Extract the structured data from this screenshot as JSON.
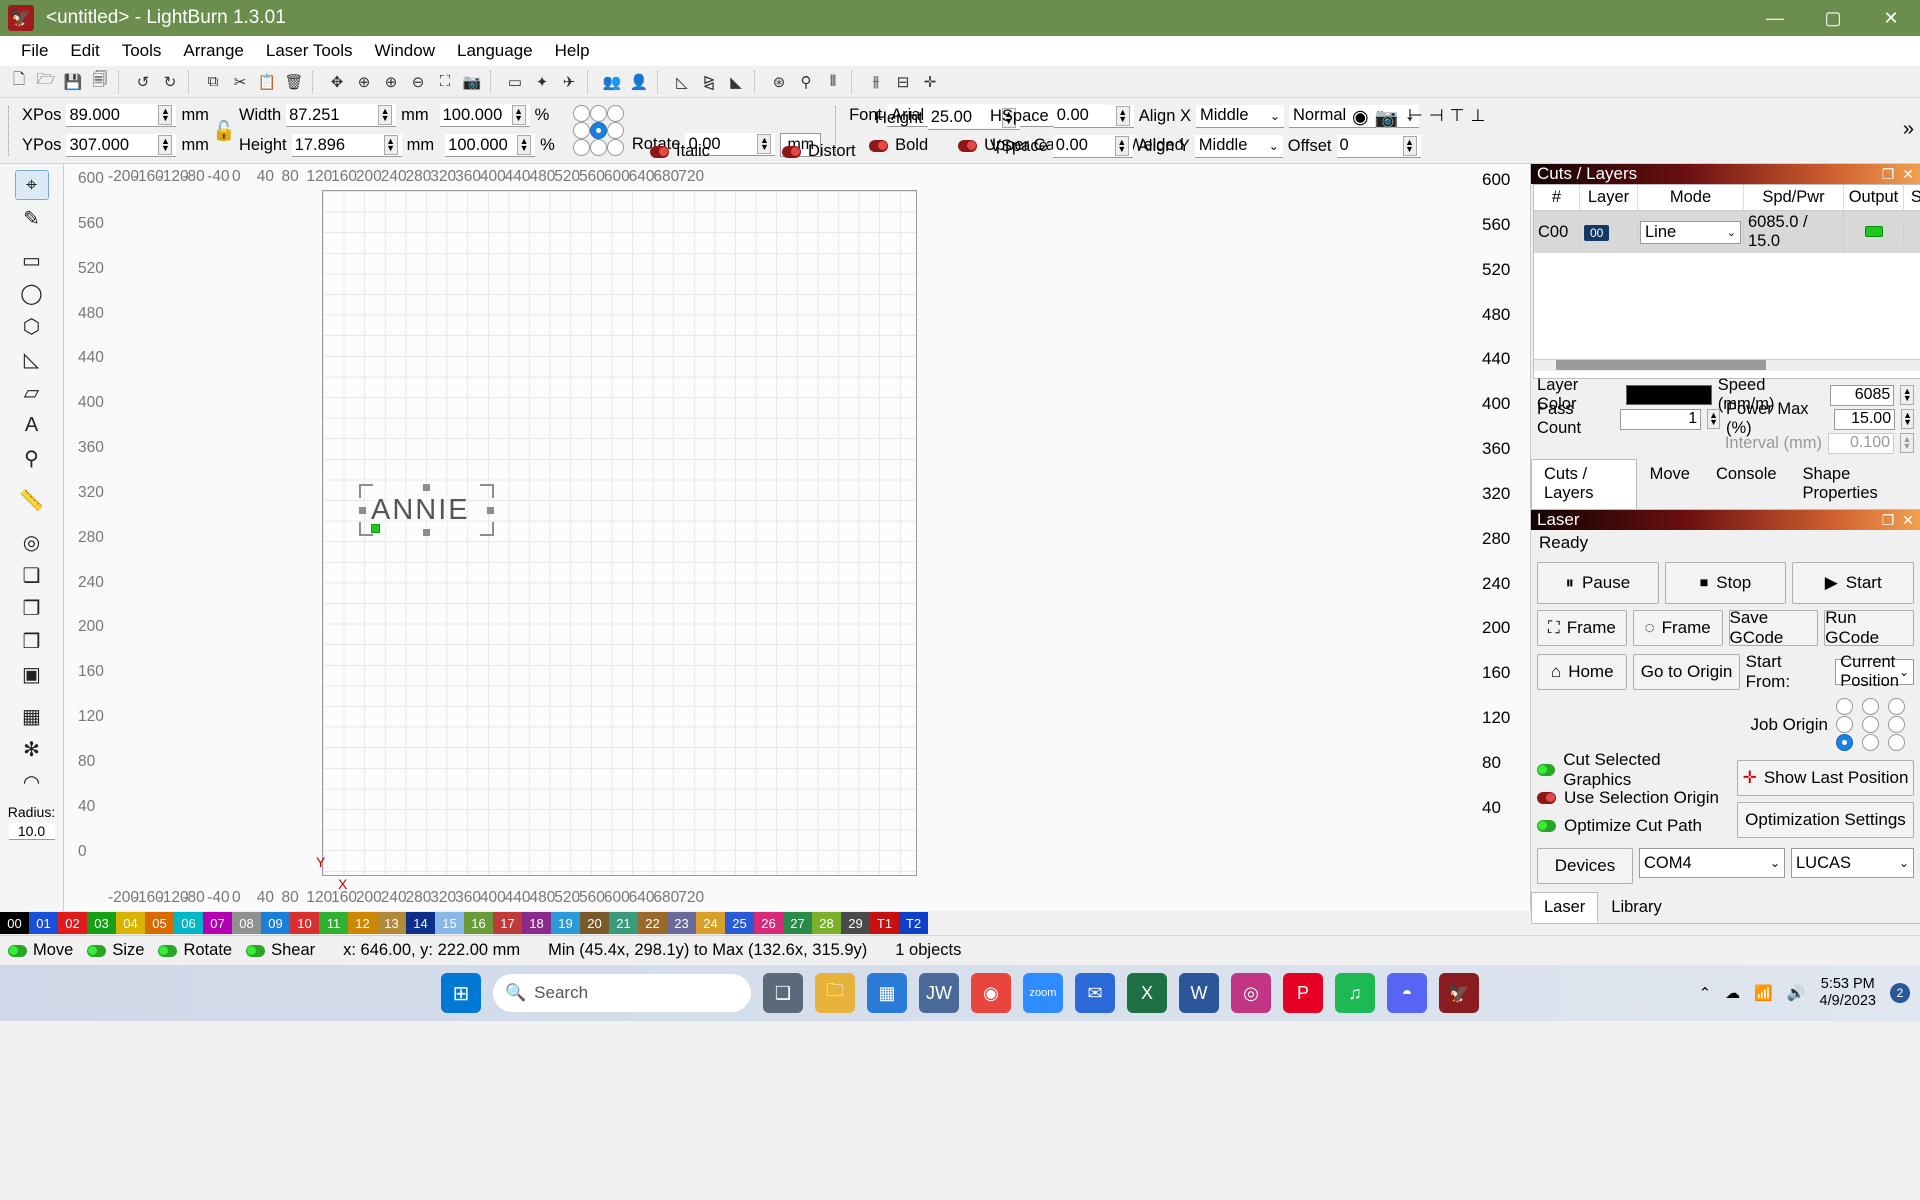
{
  "window": {
    "title": "<untitled> - LightBurn 1.3.01",
    "minimize": "—",
    "maximize": "▢",
    "close": "✕"
  },
  "menu": [
    "File",
    "Edit",
    "Tools",
    "Arrange",
    "Laser Tools",
    "Window",
    "Language",
    "Help"
  ],
  "toolbar_icons": [
    "new-file-icon",
    "open-file-icon",
    "save-file-icon",
    "export-file-icon",
    "undo-icon",
    "redo-icon",
    "copy-icon",
    "cut-icon",
    "paste-icon",
    "delete-icon",
    "move-icon",
    "zoom-icon",
    "zoom-in-icon",
    "zoom-out-icon",
    "frame-select-icon",
    "camera-icon",
    "fit-view-icon",
    "node-edit-icon",
    "boolean-icon",
    "group-icon",
    "ungroup-icon",
    "offset-icon",
    "mirror-h-icon",
    "mirror-v-icon",
    "weld-icon",
    "array-icon",
    "measure-icon",
    "align-icon",
    "distribute-icon",
    "center-icon"
  ],
  "properties": {
    "xpos_label": "XPos",
    "xpos_value": "89.000",
    "xpos_unit": "mm",
    "ypos_label": "YPos",
    "ypos_value": "307.000",
    "ypos_unit": "mm",
    "lock_icon": "unlock-icon",
    "width_label": "Width",
    "width_value": "87.251",
    "width_unit": "mm",
    "width_pct": "100.000",
    "pct_unit": "%",
    "height_label": "Height",
    "height_value": "17.896",
    "height_unit": "mm",
    "height_pct": "100.000",
    "rotate_label": "Rotate",
    "rotate_value": "0.00",
    "rotate_unit": "mm",
    "anchor_selected_index": 4,
    "more_icon": "chevron-right-icon"
  },
  "text_props": {
    "font_label": "Font",
    "font_value": "Arial",
    "height_label": "Height",
    "height_value": "25.00",
    "hspace_label": "HSpace",
    "hspace_value": "0.00",
    "vspace_label": "VSpace",
    "vspace_value": "0.00",
    "bold_label": "Bold",
    "bold_on": false,
    "italic_label": "Italic",
    "italic_on": false,
    "upper_label": "Upper Case",
    "upper_on": false,
    "distort_label": "Distort",
    "distort_on": false,
    "welded_label": "Welded",
    "welded_on": true,
    "align_x_label": "Align X",
    "align_x_value": "Middle",
    "align_y_label": "Align Y",
    "align_y_value": "Middle",
    "normal_value": "Normal",
    "offset_label": "Offset",
    "offset_value": "0"
  },
  "tools_palette": [
    {
      "name": "select-tool",
      "glyph": "⌖",
      "selected": true
    },
    {
      "name": "edit-nodes-tool",
      "glyph": "✎",
      "selected": false
    },
    {
      "name": "rectangle-tool",
      "glyph": "▭",
      "selected": false
    },
    {
      "name": "ellipse-tool",
      "glyph": "◯",
      "selected": false
    },
    {
      "name": "polygon-tool",
      "glyph": "⬡",
      "selected": false
    },
    {
      "name": "draw-line-tool",
      "glyph": "◺",
      "selected": false
    },
    {
      "name": "closed-path-tool",
      "glyph": "▱",
      "selected": false
    },
    {
      "name": "text-tool",
      "glyph": "A",
      "selected": false
    },
    {
      "name": "position-tool",
      "glyph": "⚲",
      "selected": false
    },
    {
      "name": "measure-tool",
      "glyph": "📏",
      "selected": false
    },
    {
      "name": "offset-shapes-tool",
      "glyph": "◎",
      "selected": false
    },
    {
      "name": "boolean-union-tool",
      "glyph": "❏",
      "selected": false
    },
    {
      "name": "boolean-subtract-tool",
      "glyph": "❐",
      "selected": false
    },
    {
      "name": "boolean-intersect-tool",
      "glyph": "❒",
      "selected": false
    },
    {
      "name": "boolean-exclude-tool",
      "glyph": "▣",
      "selected": false
    },
    {
      "name": "grid-array-tool",
      "glyph": "▦",
      "selected": false
    },
    {
      "name": "circular-array-tool",
      "glyph": "✻",
      "selected": false
    },
    {
      "name": "radius-tool",
      "glyph": "◠",
      "selected": false
    }
  ],
  "radius": {
    "label": "Radius:",
    "value": "10.0"
  },
  "canvas": {
    "ruler_top": [
      "-200",
      "-160",
      "-120",
      "-80",
      "-40",
      "0",
      "40",
      "80",
      "120",
      "160",
      "200",
      "240",
      "280",
      "320",
      "360",
      "400",
      "440",
      "480",
      "520",
      "560",
      "600",
      "640",
      "680",
      "720"
    ],
    "ruler_bottom": [
      "-200",
      "-160",
      "-120",
      "-80",
      "-40",
      "0",
      "40",
      "80",
      "120",
      "160",
      "200",
      "240",
      "280",
      "320",
      "360",
      "400",
      "440",
      "480",
      "520",
      "560",
      "600",
      "640",
      "680",
      "720"
    ],
    "ruler_left": [
      "600",
      "560",
      "520",
      "480",
      "440",
      "400",
      "360",
      "320",
      "280",
      "240",
      "200",
      "160",
      "120",
      "80",
      "40",
      "0"
    ],
    "ruler_right": [
      "600",
      "560",
      "520",
      "480",
      "440",
      "400",
      "360",
      "320",
      "280",
      "240",
      "200",
      "160",
      "120",
      "80",
      "40"
    ],
    "origin_x_label": "X",
    "origin_y_label": "Y",
    "object_text": "ANNIE"
  },
  "cuts_panel": {
    "title": "Cuts / Layers",
    "undock_icon": "undock-icon",
    "close_icon": "close-icon",
    "columns": [
      "#",
      "Layer",
      "Mode",
      "Spd/Pwr",
      "Output",
      "Show"
    ],
    "rows": [
      {
        "num": "C00",
        "layer": "00",
        "mode": "Line",
        "spd_pwr": "6085.0 / 15.0",
        "output": true,
        "show": true
      }
    ],
    "side_icons": [
      "scroll-up-icon",
      "scroll-down-icon",
      "delete-icon",
      "move-right-icon",
      "move-left-icon"
    ],
    "layer_color_label": "Layer Color",
    "layer_color_value": "#000000",
    "speed_label": "Speed (mm/m)",
    "speed_value": "6085",
    "pass_count_label": "Pass Count",
    "pass_count_value": "1",
    "power_max_label": "Power Max (%)",
    "power_max_value": "15.00",
    "interval_label": "Interval (mm)",
    "interval_value": "0.100"
  },
  "dock_tabs": [
    {
      "label": "Cuts / Layers",
      "active": true
    },
    {
      "label": "Move",
      "active": false
    },
    {
      "label": "Console",
      "active": false
    },
    {
      "label": "Shape Properties",
      "active": false
    }
  ],
  "laser_panel": {
    "title": "Laser",
    "status": "Ready",
    "pause_label": "Pause",
    "stop_label": "Stop",
    "start_label": "Start",
    "frame_label": "Frame",
    "frame_round_label": "Frame",
    "save_gcode_label": "Save GCode",
    "run_gcode_label": "Run GCode",
    "home_label": "Home",
    "go_to_origin_label": "Go to Origin",
    "start_from_label": "Start From:",
    "start_from_value": "Current Position",
    "job_origin_label": "Job Origin",
    "job_origin_index": 6,
    "cut_selected_label": "Cut Selected Graphics",
    "cut_selected_on": true,
    "use_selection_origin_label": "Use Selection Origin",
    "use_selection_origin_on": false,
    "optimize_cut_label": "Optimize Cut Path",
    "optimize_cut_on": true,
    "show_last_position_label": "Show Last Position",
    "optimization_settings_label": "Optimization Settings",
    "devices_label": "Devices",
    "port_value": "COM4",
    "device_value": "LUCAS"
  },
  "bottom_tabs": [
    {
      "label": "Laser",
      "active": true
    },
    {
      "label": "Library",
      "active": false
    }
  ],
  "palette": [
    {
      "label": "00",
      "color": "#000000"
    },
    {
      "label": "01",
      "color": "#1b4fd8"
    },
    {
      "label": "02",
      "color": "#e01b1b"
    },
    {
      "label": "03",
      "color": "#15a015"
    },
    {
      "label": "04",
      "color": "#d8b400"
    },
    {
      "label": "05",
      "color": "#d86a00"
    },
    {
      "label": "06",
      "color": "#00b7c8"
    },
    {
      "label": "07",
      "color": "#b200b2"
    },
    {
      "label": "08",
      "color": "#909090"
    },
    {
      "label": "09",
      "color": "#1b7fd8"
    },
    {
      "label": "10",
      "color": "#d83030"
    },
    {
      "label": "11",
      "color": "#30b030"
    },
    {
      "label": "12",
      "color": "#cc8800"
    },
    {
      "label": "13",
      "color": "#b08a3a"
    },
    {
      "label": "14",
      "color": "#0d2f8a"
    },
    {
      "label": "15",
      "color": "#8ab7e8"
    },
    {
      "label": "16",
      "color": "#6a9a3a"
    },
    {
      "label": "17",
      "color": "#c03a3a"
    },
    {
      "label": "18",
      "color": "#8a2a8a"
    },
    {
      "label": "19",
      "color": "#2a9ad8"
    },
    {
      "label": "20",
      "color": "#7a5a2a"
    },
    {
      "label": "21",
      "color": "#3a9a7a"
    },
    {
      "label": "22",
      "color": "#9a6a2a"
    },
    {
      "label": "23",
      "color": "#6a6a9a"
    },
    {
      "label": "24",
      "color": "#d8a02a"
    },
    {
      "label": "25",
      "color": "#2a5ad8"
    },
    {
      "label": "26",
      "color": "#d82a7a"
    },
    {
      "label": "27",
      "color": "#2a8a4a"
    },
    {
      "label": "28",
      "color": "#7ab02a"
    },
    {
      "label": "29",
      "color": "#4a4a4a"
    },
    {
      "label": "T1",
      "color": "#c81010"
    },
    {
      "label": "T2",
      "color": "#1040c8"
    }
  ],
  "status_bar": {
    "move_label": "Move",
    "size_label": "Size",
    "rotate_label": "Rotate",
    "shear_label": "Shear",
    "coords": "x: 646.00, y: 222.00 mm",
    "extents": "Min (45.4x, 298.1y) to Max (132.6x, 315.9y)",
    "object_count": "1 objects"
  },
  "taskbar": {
    "search_placeholder": "Search",
    "search_icon": "search-icon",
    "start_icon": "windows-start-icon",
    "apps": [
      {
        "name": "task-view-icon",
        "glyph": "❑",
        "color": "#5a6a7a"
      },
      {
        "name": "file-explorer-icon",
        "glyph": "🗀",
        "color": "#e8b33a"
      },
      {
        "name": "microsoft-store-icon",
        "glyph": "▦",
        "color": "#2a7ad8"
      },
      {
        "name": "jw-library-icon",
        "glyph": "JW",
        "color": "#4a6a9a"
      },
      {
        "name": "google-chrome-icon",
        "glyph": "◉",
        "color": "#e8453c"
      },
      {
        "name": "zoom-icon",
        "glyph": "zoom",
        "color": "#2d8cff"
      },
      {
        "name": "mail-icon",
        "glyph": "✉",
        "color": "#2a6ad8"
      },
      {
        "name": "excel-icon",
        "glyph": "X",
        "color": "#1d7044"
      },
      {
        "name": "word-icon",
        "glyph": "W",
        "color": "#2b579a"
      },
      {
        "name": "instagram-icon",
        "glyph": "◎",
        "color": "#c13584"
      },
      {
        "name": "pinterest-icon",
        "glyph": "P",
        "color": "#e60023"
      },
      {
        "name": "spotify-icon",
        "glyph": "♫",
        "color": "#1db954"
      },
      {
        "name": "discord-icon",
        "glyph": "◓",
        "color": "#5865f2"
      },
      {
        "name": "lightburn-icon",
        "glyph": "🦅",
        "color": "#8a1b20"
      }
    ],
    "tray_icons": [
      "chevron-up-icon",
      "cloud-icon",
      "wifi-icon",
      "volume-icon"
    ],
    "time": "5:53 PM",
    "date": "4/9/2023",
    "notification_count": "2"
  }
}
